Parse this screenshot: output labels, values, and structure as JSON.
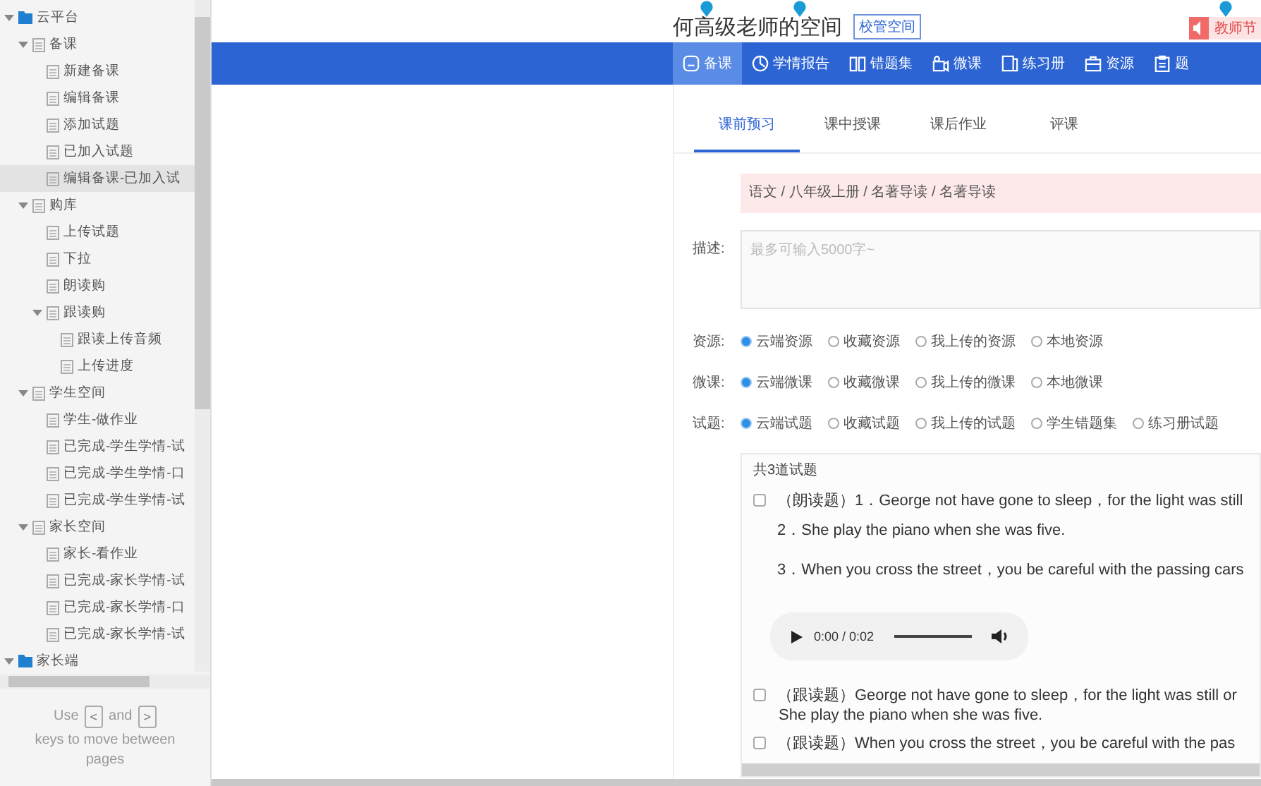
{
  "sidebar": {
    "tree": [
      {
        "label": "云平台",
        "kind": "folder",
        "expanded": true,
        "selected": false,
        "children": [
          {
            "label": "备课",
            "kind": "page",
            "expanded": true,
            "selected": false,
            "children": [
              {
                "label": "新建备课",
                "kind": "page",
                "selected": false
              },
              {
                "label": "编辑备课",
                "kind": "page",
                "selected": false
              },
              {
                "label": "添加试题",
                "kind": "page",
                "selected": false
              },
              {
                "label": "已加入试题",
                "kind": "page",
                "selected": false
              },
              {
                "label": "编辑备课-已加入试",
                "kind": "page",
                "selected": true
              }
            ]
          },
          {
            "label": "购库",
            "kind": "page",
            "expanded": true,
            "selected": false,
            "children": [
              {
                "label": "上传试题",
                "kind": "page",
                "selected": false
              },
              {
                "label": "下拉",
                "kind": "page",
                "selected": false
              },
              {
                "label": "朗读购",
                "kind": "page",
                "selected": false
              },
              {
                "label": "跟读购",
                "kind": "page",
                "expanded": true,
                "selected": false,
                "children": [
                  {
                    "label": "跟读上传音频",
                    "kind": "page",
                    "selected": false
                  },
                  {
                    "label": "上传进度",
                    "kind": "page",
                    "selected": false
                  }
                ]
              }
            ]
          },
          {
            "label": "学生空间",
            "kind": "page",
            "expanded": true,
            "selected": false,
            "children": [
              {
                "label": "学生-做作业",
                "kind": "page",
                "selected": false
              },
              {
                "label": "已完成-学生学情-试",
                "kind": "page",
                "selected": false
              },
              {
                "label": "已完成-学生学情-口",
                "kind": "page",
                "selected": false
              },
              {
                "label": "已完成-学生学情-试",
                "kind": "page",
                "selected": false
              }
            ]
          },
          {
            "label": "家长空间",
            "kind": "page",
            "expanded": true,
            "selected": false,
            "children": [
              {
                "label": "家长-看作业",
                "kind": "page",
                "selected": false
              },
              {
                "label": "已完成-家长学情-试",
                "kind": "page",
                "selected": false
              },
              {
                "label": "已完成-家长学情-口",
                "kind": "page",
                "selected": false
              },
              {
                "label": "已完成-家长学情-试",
                "kind": "page",
                "selected": false
              }
            ]
          }
        ]
      },
      {
        "label": "家长端",
        "kind": "folder",
        "expanded": true,
        "selected": false
      }
    ],
    "help": {
      "before": "Use",
      "key_prev": "<",
      "middle": "and",
      "key_next": ">",
      "after": "keys to move between pages"
    }
  },
  "header": {
    "title": "何高级老师的空间",
    "badge": "校管空间",
    "notice": "教师节"
  },
  "nav": [
    {
      "label": "备课",
      "selected": true
    },
    {
      "label": "学情报告",
      "selected": false
    },
    {
      "label": "错题集",
      "selected": false
    },
    {
      "label": "微课",
      "selected": false
    },
    {
      "label": "练习册",
      "selected": false
    },
    {
      "label": "资源",
      "selected": false
    },
    {
      "label": "题",
      "selected": false
    }
  ],
  "tabs": [
    {
      "label": "课前预习",
      "selected": true
    },
    {
      "label": "课中授课",
      "selected": false
    },
    {
      "label": "课后作业",
      "selected": false
    },
    {
      "label": "评课",
      "selected": false
    }
  ],
  "breadcrumb": "语文 / 八年级上册 / 名著导读  /  名著导读",
  "description": {
    "label": "描述:",
    "placeholder": "最多可输入5000字~"
  },
  "radio_groups": [
    {
      "label": "资源:",
      "options": [
        {
          "label": "云端资源",
          "selected": true
        },
        {
          "label": "收藏资源",
          "selected": false
        },
        {
          "label": "我上传的资源",
          "selected": false
        },
        {
          "label": "本地资源",
          "selected": false
        }
      ]
    },
    {
      "label": "微课:",
      "options": [
        {
          "label": "云端微课",
          "selected": true
        },
        {
          "label": "收藏微课",
          "selected": false
        },
        {
          "label": "我上传的微课",
          "selected": false
        },
        {
          "label": "本地微课",
          "selected": false
        }
      ]
    },
    {
      "label": "试题:",
      "options": [
        {
          "label": "云端试题",
          "selected": true
        },
        {
          "label": "收藏试题",
          "selected": false
        },
        {
          "label": "我上传的试题",
          "selected": false
        },
        {
          "label": "学生错题集",
          "selected": false
        },
        {
          "label": "练习册试题",
          "selected": false
        }
      ]
    }
  ],
  "questions": {
    "count": "共3道试题",
    "items": [
      {
        "checked": false,
        "lines": [
          "（朗读题）1．George  not have gone to sleep，for the light was still",
          "2．She play the piano when she was five.",
          "3．When you cross the street，you  be careful with the passing cars"
        ],
        "audio": {
          "time": "0:00 / 0:02"
        }
      },
      {
        "checked": false,
        "lines": [
          "（跟读题）George  not have gone to sleep，for the light was still or",
          "She  play the piano when she was five."
        ]
      },
      {
        "checked": false,
        "lines": [
          "（跟读题）When you cross the street，you   be careful with the pas"
        ]
      }
    ]
  }
}
